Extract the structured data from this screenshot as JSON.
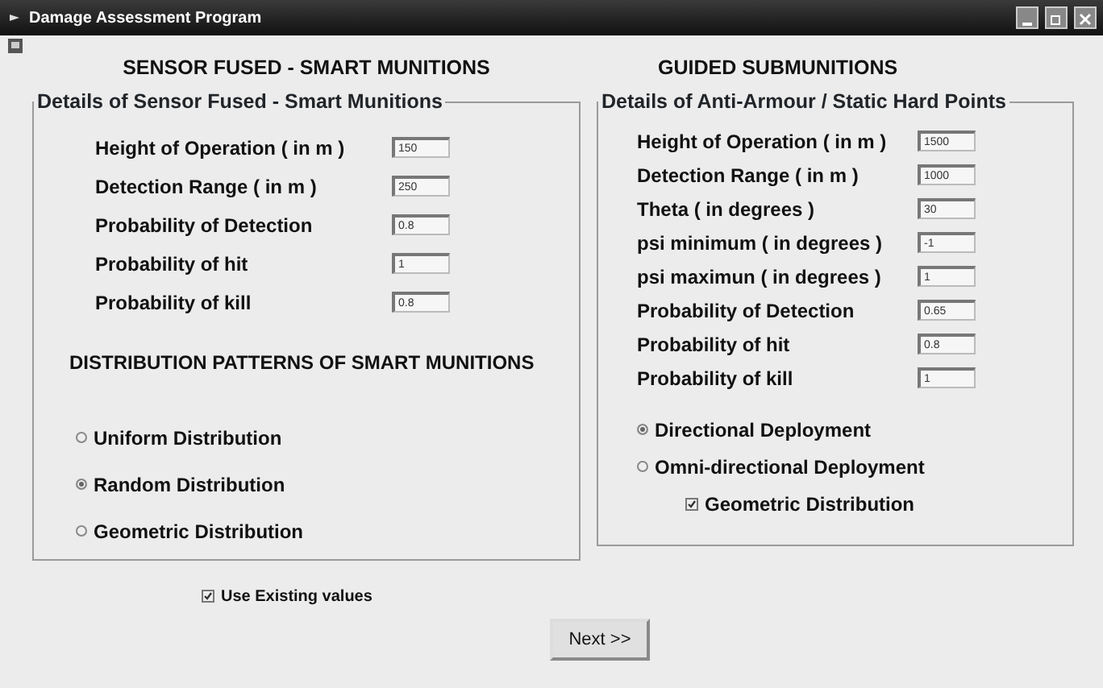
{
  "window": {
    "title": "Damage Assessment Program"
  },
  "left": {
    "heading": "SENSOR FUSED - SMART MUNITIONS",
    "group": "Details of Sensor Fused - Smart Munitions",
    "fields": [
      {
        "label": "Height of Operation ( in m )",
        "value": "150"
      },
      {
        "label": "Detection Range ( in m )",
        "value": "250"
      },
      {
        "label": "Probability of Detection",
        "value": "0.8"
      },
      {
        "label": "Probability of hit",
        "value": "1"
      },
      {
        "label": "Probability of kill",
        "value": "0.8"
      }
    ],
    "subheading": "DISTRIBUTION PATTERNS  OF SMART MUNITIONS",
    "options": [
      {
        "label": "Uniform Distribution",
        "selected": false
      },
      {
        "label": "Random Distribution",
        "selected": true
      },
      {
        "label": "Geometric Distribution",
        "selected": false
      }
    ]
  },
  "right": {
    "heading": "GUIDED  SUBMUNITIONS",
    "group": "Details of Anti-Armour / Static Hard Points",
    "fields": [
      {
        "label": "Height of Operation ( in m )",
        "value": "1500"
      },
      {
        "label": "Detection Range ( in m )",
        "value": "1000"
      },
      {
        "label": "Theta ( in degrees )",
        "value": "30"
      },
      {
        "label": "psi minimum ( in degrees )",
        "value": "-1"
      },
      {
        "label": "psi maximun ( in degrees )",
        "value": "1"
      },
      {
        "label": "Probability of Detection",
        "value": "0.65"
      },
      {
        "label": "Probability of hit",
        "value": "0.8"
      },
      {
        "label": "Probability of kill",
        "value": "1"
      }
    ],
    "options": [
      {
        "label": "Directional Deployment",
        "selected": true
      },
      {
        "label": "Omni-directional Deployment",
        "selected": false
      }
    ],
    "checkbox": {
      "label": "Geometric Distribution",
      "checked": true
    }
  },
  "use_existing": {
    "label": "Use Existing values",
    "checked": true
  },
  "next_button": "Next >>"
}
